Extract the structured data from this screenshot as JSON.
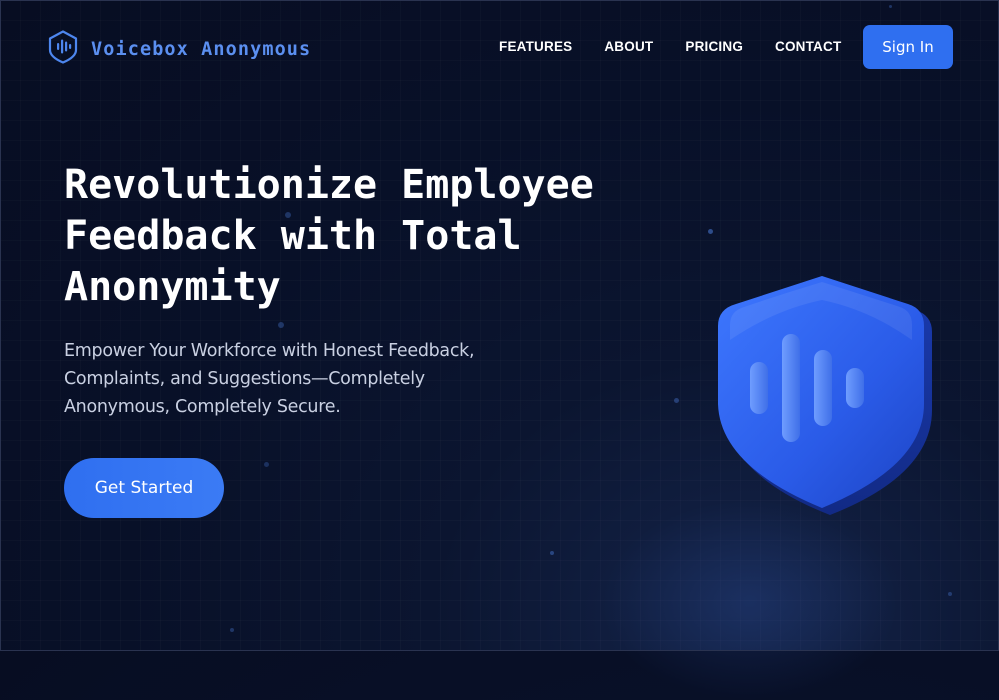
{
  "brand": {
    "name": "Voicebox Anonymous"
  },
  "nav": {
    "items": [
      {
        "label": "FEATURES"
      },
      {
        "label": "ABOUT"
      },
      {
        "label": "PRICING"
      },
      {
        "label": "CONTACT"
      }
    ],
    "signin_label": "Sign In"
  },
  "hero": {
    "title_line1": "Revolutionize Employee",
    "title_line2": "Feedback with Total",
    "title_line3": "Anonymity",
    "subtitle_line1": "Empower Your Workforce with Honest Feedback,",
    "subtitle_line2": "Complaints, and Suggestions—Completely",
    "subtitle_line3": "Anonymous, Completely Secure.",
    "cta_label": "Get Started"
  },
  "icons": {
    "logo": "shield-soundwave-icon",
    "hero_graphic": "shield-soundwave-icon"
  },
  "colors": {
    "background": "#081028",
    "accent": "#2f6ff0",
    "brand_text": "#5b8ff0",
    "subtitle_text": "#c9d0e2"
  }
}
